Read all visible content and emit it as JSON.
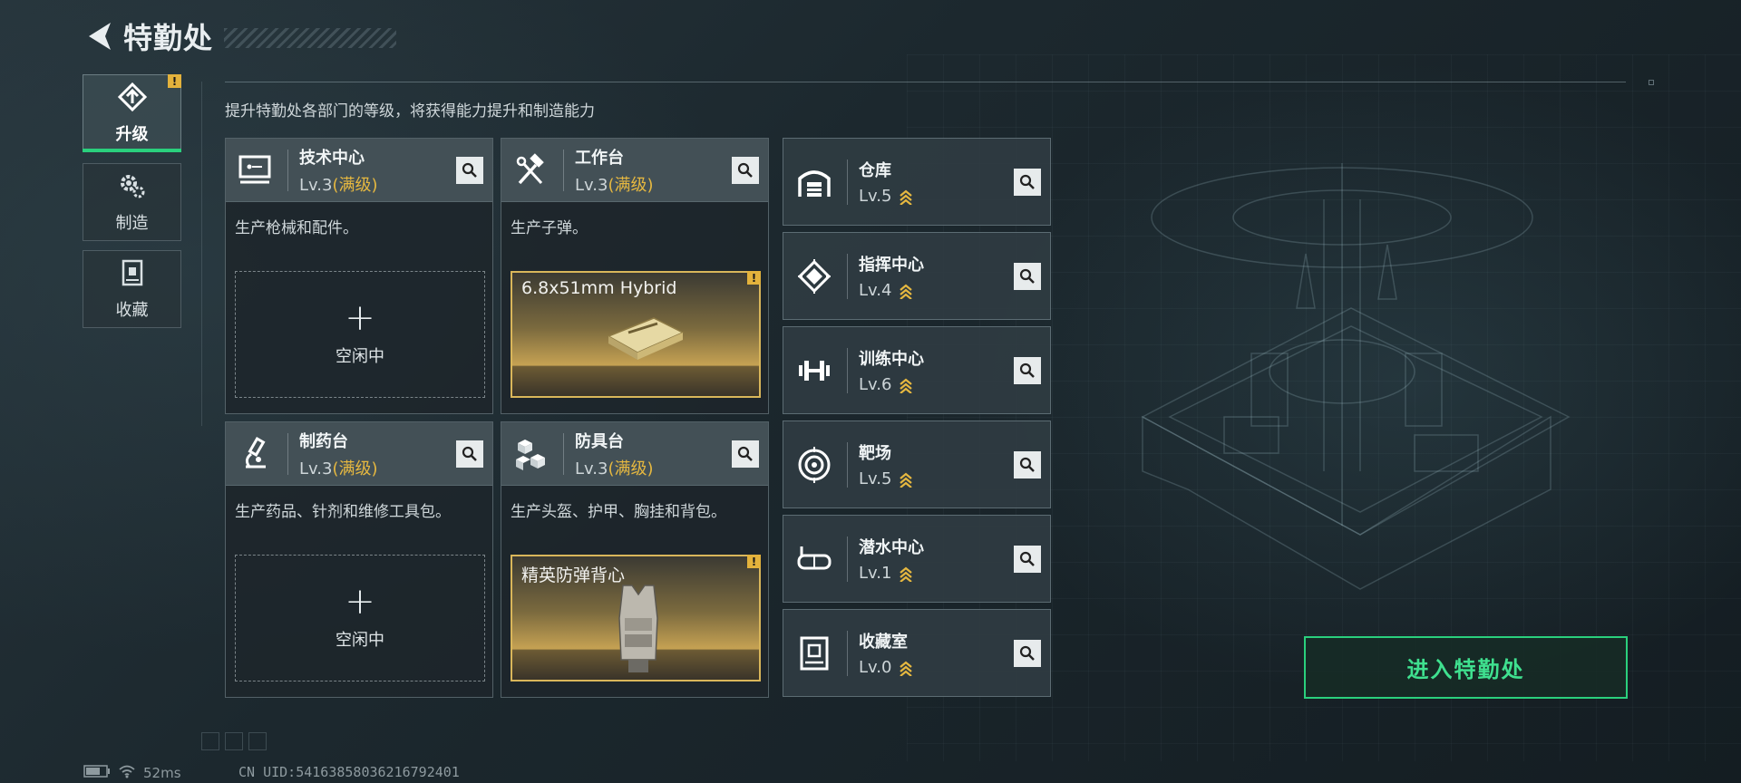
{
  "header": {
    "title": "特勤处"
  },
  "subtitle": "提升特勤处各部门的等级，将获得能力提升和制造能力",
  "sidebar": {
    "items": [
      {
        "label": "升级",
        "icon": "upgrade-icon",
        "active": true,
        "alert": "!"
      },
      {
        "label": "制造",
        "icon": "gears-icon",
        "active": false
      },
      {
        "label": "收藏",
        "icon": "collection-icon",
        "active": false
      }
    ]
  },
  "workshops": [
    {
      "name": "技术中心",
      "level": "Lv.3",
      "max_label": "(满级)",
      "icon": "monitor-icon",
      "description": "生产枪械和配件。",
      "slot_state": "idle",
      "slot_label": "空闲中",
      "slot_plus": "+"
    },
    {
      "name": "工作台",
      "level": "Lv.3",
      "max_label": "(满级)",
      "icon": "hammer-wrench-icon",
      "description": "生产子弹。",
      "slot_state": "product",
      "product_name": "6.8x51mm Hybrid",
      "product_alert": "!"
    },
    {
      "name": "制药台",
      "level": "Lv.3",
      "max_label": "(满级)",
      "icon": "microscope-icon",
      "description": "生产药品、针剂和维修工具包。",
      "slot_state": "idle",
      "slot_label": "空闲中",
      "slot_plus": "+"
    },
    {
      "name": "防具台",
      "level": "Lv.3",
      "max_label": "(满级)",
      "icon": "armor-blocks-icon",
      "description": "生产头盔、护甲、胸挂和背包。",
      "slot_state": "product",
      "product_name": "精英防弹背心",
      "product_alert": "!"
    }
  ],
  "facilities": [
    {
      "name": "仓库",
      "level": "Lv.5",
      "icon": "warehouse-icon"
    },
    {
      "name": "指挥中心",
      "level": "Lv.4",
      "icon": "command-chip-icon"
    },
    {
      "name": "训练中心",
      "level": "Lv.6",
      "icon": "dumbbell-icon"
    },
    {
      "name": "靶场",
      "level": "Lv.5",
      "icon": "target-icon"
    },
    {
      "name": "潜水中心",
      "level": "Lv.1",
      "icon": "diving-mask-icon"
    },
    {
      "name": "收藏室",
      "level": "Lv.0",
      "icon": "display-case-icon"
    }
  ],
  "enter_button": "进入特勤处",
  "status": {
    "ping": "52ms",
    "uid": "CN UID:54163858036216792401"
  },
  "colors": {
    "accent_green": "#2ad07d",
    "gold": "#e6b840",
    "alert": "#e3b23c"
  }
}
